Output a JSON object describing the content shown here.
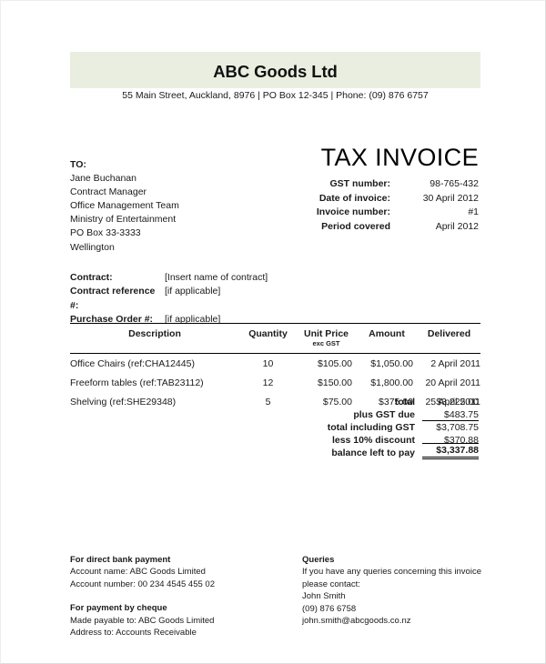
{
  "company": {
    "name": "ABC Goods Ltd",
    "address": "55 Main Street, Auckland, 8976 | PO Box 12-345 | Phone: (09) 876 6757"
  },
  "title": "TAX INVOICE",
  "recipient": {
    "label": "TO:",
    "lines": [
      "Jane Buchanan",
      "Contract Manager",
      "Office Management Team",
      "Ministry of Entertainment",
      "PO Box 33-3333",
      "Wellington"
    ]
  },
  "meta": [
    {
      "label": "GST number:",
      "value": "98-765-432"
    },
    {
      "label": "Date of invoice:",
      "value": "30 April 2012"
    },
    {
      "label": "Invoice number:",
      "value": "#1"
    },
    {
      "label": "Period covered",
      "value": "April 2012"
    }
  ],
  "contract": [
    {
      "label": "Contract:",
      "value": "[Insert name of contract]"
    },
    {
      "label": "Contract reference #:",
      "value": "[if applicable]"
    },
    {
      "label": "Purchase Order #:",
      "value": "[if applicable]"
    }
  ],
  "table": {
    "headers": {
      "description": "Description",
      "quantity": "Quantity",
      "unit_price": "Unit Price",
      "unit_price_sub": "exc GST",
      "amount": "Amount",
      "delivered": "Delivered"
    },
    "rows": [
      {
        "description": "Office Chairs (ref:CHA12445)",
        "quantity": "10",
        "unit_price": "$105.00",
        "amount": "$1,050.00",
        "delivered": "2 April 2011"
      },
      {
        "description": "Freeform tables (ref:TAB23112)",
        "quantity": "12",
        "unit_price": "$150.00",
        "amount": "$1,800.00",
        "delivered": "20 April 2011"
      },
      {
        "description": "Shelving (ref:SHE29348)",
        "quantity": "5",
        "unit_price": "$75.00",
        "amount": "$375.00",
        "delivered": "25 April 2011"
      }
    ]
  },
  "totals": [
    {
      "label": "total",
      "value": "$3,225.00"
    },
    {
      "label": "plus GST due",
      "value": "$483.75"
    },
    {
      "label": "total including GST",
      "value": "$3,708.75"
    },
    {
      "label": "less 10% discount",
      "value": "$370.88"
    },
    {
      "label": "balance left to pay",
      "value": "$3,337.88"
    }
  ],
  "footer": {
    "bank": {
      "heading": "For direct bank payment",
      "line1": "Account name: ABC Goods Limited",
      "line2": "Account number: 00 234 4545 455 02"
    },
    "cheque": {
      "heading": "For payment by cheque",
      "line1": "Made payable to: ABC Goods Limited",
      "line2": "Address to: Accounts Receivable"
    },
    "queries": {
      "heading": "Queries",
      "line1": "If you have any queries concerning this invoice",
      "line2": "please contact:",
      "line3": "John Smith",
      "line4": "(09) 876 6758",
      "line5": "john.smith@abcgoods.co.nz"
    }
  },
  "colors": {
    "band": "#eaeee0",
    "text": "#1a1a1a",
    "rule": "#000000"
  }
}
